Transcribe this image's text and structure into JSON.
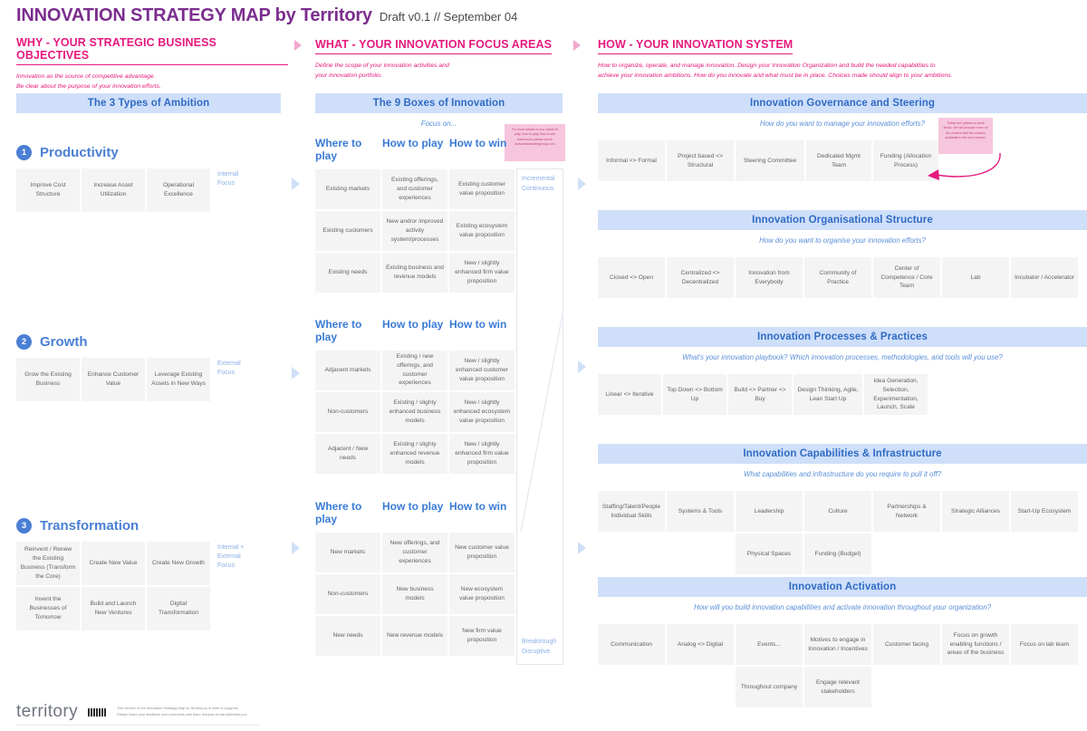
{
  "title": {
    "main": "INNOVATION STRATEGY MAP by Territory",
    "sub": "Draft v0.1 // September 04"
  },
  "columns": {
    "why": {
      "heading": "WHY -  YOUR STRATEGIC BUSINESS OBJECTIVES",
      "description": "Innovation as the source of competitive advantage.\nBe clear about the purpose of your innovation efforts.",
      "banner": "The 3 Types of Ambition",
      "ambitions": [
        {
          "number": "1",
          "name": "Productivity",
          "focus": "Internal\nFocus",
          "rows": [
            [
              "Improve Cost Structure",
              "Increase Asset Utilization",
              "Operational Excellence"
            ]
          ]
        },
        {
          "number": "2",
          "name": "Growth",
          "focus": "External\nFocus",
          "rows": [
            [
              "Grow the Existing Business",
              "Enhance Customer Value",
              "Leverage Existing Assets in New Ways"
            ]
          ]
        },
        {
          "number": "3",
          "name": "Transformation",
          "focus": "Internal +\nExternal\nFocus",
          "rows": [
            [
              "Reinvent / Renew the Existing Business (Transform the Core)",
              "Create New Value",
              "Create New Growth"
            ],
            [
              "Invent the Businesses of Tomorrow",
              "Build and Launch New Ventures",
              "Digital Transformation"
            ]
          ]
        }
      ]
    },
    "what": {
      "heading": "WHAT -  YOUR INNOVATION FOCUS AREAS",
      "description": "Define the scope of your innovation activities and\nyour innovation portfolio.",
      "banner": "The 9 Boxes of Innovation",
      "focus_on": "Focus on...",
      "column_headers": [
        "Where to play",
        "How to play",
        "How to win"
      ],
      "sticky_note": "For more details in our Latest 9x play, how to play, how to win framework please check www.teamstrategymap.com",
      "blocks": [
        {
          "rows": [
            [
              "Existing markets",
              "Existing offerings, and customer experiences",
              "Existing customer value proposition"
            ],
            [
              "Existing customers",
              "New and/or improved activity system/processes",
              "Existing ecosystem value proposition"
            ],
            [
              "Existing needs",
              "Existing business and revenue models",
              "New / slightly enhanced firm value proposition"
            ]
          ]
        },
        {
          "rows": [
            [
              "Adjacent markets",
              "Existing / new offerings, and customer experiences",
              "New / slightly enhanced customer value proposition"
            ],
            [
              "Non-customers",
              "Existing / slighty enhanced business models",
              "New / slightly enhanced ecosystem value proposition"
            ],
            [
              "Adjacent / New needs",
              "Existing / slighty enhanced revenue models",
              "New / slightly enhanced firm value proposition"
            ]
          ]
        },
        {
          "rows": [
            [
              "New markets",
              "New offerings, and customer experiences",
              "New customer value proposition"
            ],
            [
              "Non-customers",
              "New business models",
              "New ecosystem value proposition"
            ],
            [
              "New needs",
              "New revenue models",
              "New firm value proposition"
            ]
          ]
        }
      ],
      "continuum_top": "Incremental\nContinuous",
      "continuum_bottom": "Breaktrough\nDisruptive"
    },
    "how": {
      "heading": "HOW -  YOUR INNOVATION SYSTEM",
      "description": "How to organize, operate, and manage innovation. Design your Innovation Organization and build the needed capabilities to\nachieve your innovation ambitions. How do you innovate and what must be in place. Choices made should align to your ambitions.",
      "sticky_note": "These are options to work about. We will provide more on the content and the choices available in the next version.",
      "sections": [
        {
          "banner": "Innovation Governance and Steering",
          "subtitle": "How do you want to manage your innovation efforts?",
          "rows": [
            [
              "Informal <> Formal",
              "Project based <> Structural",
              "Steering Committee",
              "Dedicated Mgmt Team",
              "Funding (Allocation Process)"
            ]
          ]
        },
        {
          "banner": "Innovation Organisational Structure",
          "subtitle": "How do you want to organise your innovation efforts?",
          "rows": [
            [
              "Closed <> Open",
              "Centralized <> Decentralized",
              "Innovation from Everybody",
              "Community of Practice",
              "Center of Competence / Core Team",
              "Lab",
              "Incubator / Accelerator"
            ]
          ]
        },
        {
          "banner": "Innovation Processes & Practices",
          "subtitle": "What's your innovation playbook? Which innovation processes, methodologies, and tools will you use?",
          "rows": [
            [
              "Linear <> Iterative",
              "Top Down <> Bottom Up",
              "Build <> Partner <> Buy",
              "Design Thinking, Agile, Lean Start Up",
              "Idea Generation, Selection, Experimentation, Launch, Scale"
            ]
          ]
        },
        {
          "banner": "Innovation Capabilities & Infrastructure",
          "subtitle": "What capabilities and infrastructure do you require to pull it off?",
          "rows": [
            [
              "Staffing/Talent/People Individual Skills",
              "Systems & Tools",
              "Leadership",
              "Culture",
              "Partnerships & Network",
              "Strategic Alliances",
              "Start-Up Ecosystem"
            ],
            [
              "Physical Spaces",
              "Funding (Budget)"
            ]
          ]
        },
        {
          "banner": "Innovation Activation",
          "subtitle": "How will you build innovation capabilities and activate innovation throughout your organization?",
          "rows": [
            [
              "Communication",
              "Analog <> Digtial",
              "Events...",
              "Motives to engage in Innovation / Incentives",
              "Customer facing",
              "Focus on growth enabling functions / areas of the business",
              "Focus on lab team"
            ],
            [
              "Throughout company",
              "Engage relevant stakeholders"
            ]
          ]
        }
      ]
    }
  },
  "footer": {
    "logo": "territory",
    "text": "This version of the Innovation Strategy Map by Territory.co is work in progress.\nPlease share your feedback and comments with Marc Sniukas at marc@territory.co"
  },
  "colors": {
    "magenta": "#e6187d",
    "purple": "#7b2d8e",
    "blue": "#4a7fd4",
    "banner_bg": "#cfdffa",
    "card_bg": "#f4f4f5",
    "sticky": "#f6c6dd"
  }
}
